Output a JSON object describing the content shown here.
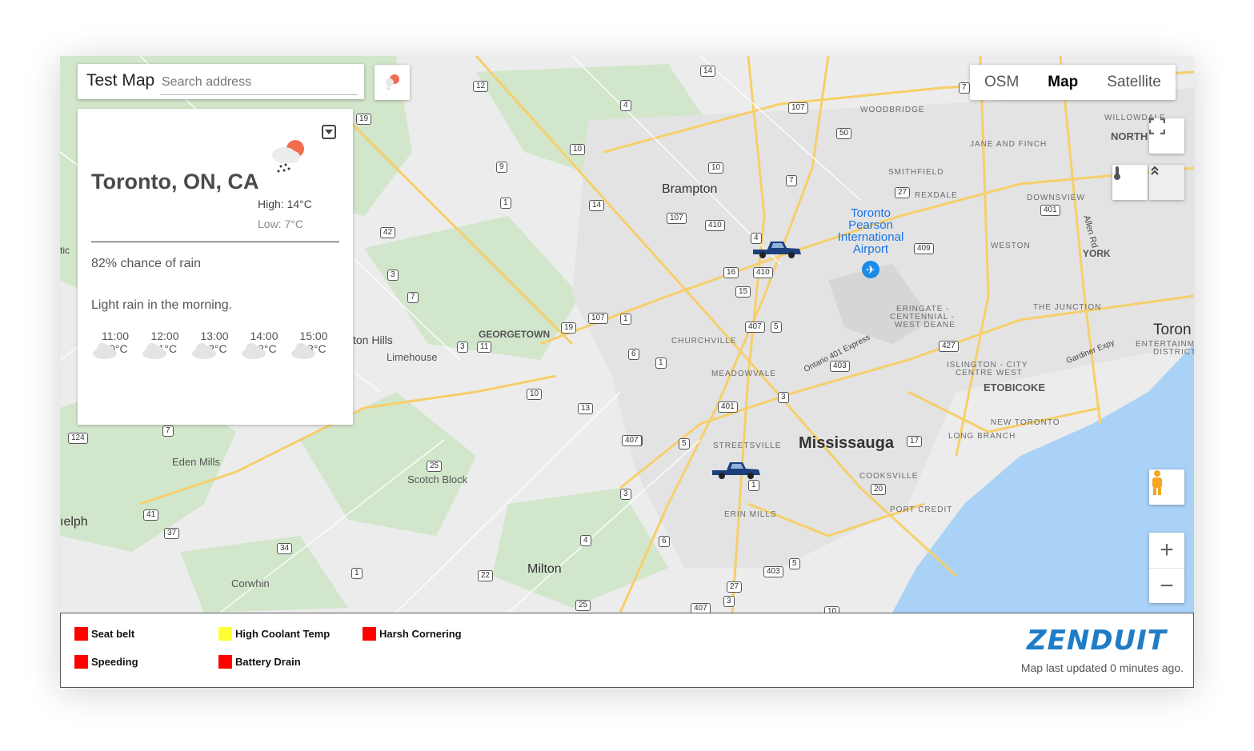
{
  "map": {
    "title": "Test Map",
    "search_placeholder": "Search address",
    "map_types": [
      "OSM",
      "Map",
      "Satellite"
    ],
    "active_map_type": "Map",
    "zoom_in": "+",
    "zoom_out": "−",
    "place_labels": {
      "brampton": "Brampton",
      "mississauga": "Mississauga",
      "milton": "Milton",
      "georgetown": "GEORGETOWN",
      "limehouse": "Limehouse",
      "eden_mills": "Eden Mills",
      "scotch_block": "Scotch Block",
      "corwhin": "Corwhin",
      "guelph": "ıelph",
      "ton_hills": "ton Hills",
      "woodbridge": "WOODBRIDGE",
      "smithfield": "SMITHFIELD",
      "rexdale": "REXDALE",
      "jane_finch": "JANE AND FINCH",
      "north": "NORTH",
      "willowdale": "WILLOWDALE",
      "downsview": "DOWNSVIEW",
      "weston": "WESTON",
      "york": "YORK",
      "the_junction": "THE JUNCTION",
      "toronto": "Toron",
      "entertainment": "ENTERTAINM",
      "district": "DISTRICT",
      "erin_mills": "ERIN MILLS",
      "streetsville": "STREETSVILLE",
      "meadowvale": "MEADOWVALE",
      "churchville": "CHURCHVILLE",
      "etobicoke": "ETOBICOKE",
      "islington": "ISLINGTON - CITY",
      "centre_west": "CENTRE WEST",
      "new_toronto": "NEW TORONTO",
      "long_branch": "LONG BRANCH",
      "cooksville": "COOKSVILLE",
      "port_credit": "PORT CREDIT",
      "eringate_1": "ERINGATE -",
      "eringate_2": "CENTENNIAL -",
      "eringate_3": "WEST DEANE",
      "allen_rd": "Allen Rd",
      "gardiner": "Gardiner Expy",
      "ontario_401": "Ontario 401 Express",
      "airport_1": "Toronto",
      "airport_2": "Pearson",
      "airport_3": "International",
      "airport_4": "Airport",
      "tic": "tic"
    },
    "shields": [
      "12",
      "14",
      "4",
      "19",
      "10",
      "9",
      "1",
      "14",
      "42",
      "3",
      "7",
      "107",
      "19",
      "3",
      "11",
      "10",
      "13",
      "407",
      "3",
      "25",
      "7",
      "124",
      "41",
      "37",
      "34",
      "1",
      "22",
      "4",
      "6",
      "1",
      "6",
      "1",
      "107",
      "410",
      "16",
      "410",
      "15",
      "4",
      "407",
      "5",
      "10",
      "7",
      "107",
      "50",
      "7",
      "27",
      "409",
      "401",
      "427",
      "403",
      "3",
      "401",
      "5",
      "407",
      "17",
      "20",
      "403",
      "5",
      "27",
      "3",
      "1",
      "25",
      "407",
      "10"
    ]
  },
  "weather": {
    "city": "Toronto, ON, CA",
    "high": "High: 14°C",
    "low": "Low: 7°C",
    "rain_chance": "82% chance of rain",
    "summary": "Light rain in the morning.",
    "hours": [
      {
        "time": "11:00",
        "temp": "10°C"
      },
      {
        "time": "12:00",
        "temp": "11°C"
      },
      {
        "time": "13:00",
        "temp": "12°C"
      },
      {
        "time": "14:00",
        "temp": "12°C"
      },
      {
        "time": "15:00",
        "temp": "13°C"
      }
    ]
  },
  "legend": {
    "items": [
      {
        "label": "Seat belt",
        "color": "#ff0000"
      },
      {
        "label": "High Coolant Temp",
        "color": "#ffff33"
      },
      {
        "label": "Harsh Cornering",
        "color": "#ff0000"
      },
      {
        "label": "Speeding",
        "color": "#ff0000"
      },
      {
        "label": "Battery Drain",
        "color": "#ff0000"
      }
    ],
    "brand": "ZENDUIT",
    "updated": "Map last updated 0 minutes ago."
  }
}
